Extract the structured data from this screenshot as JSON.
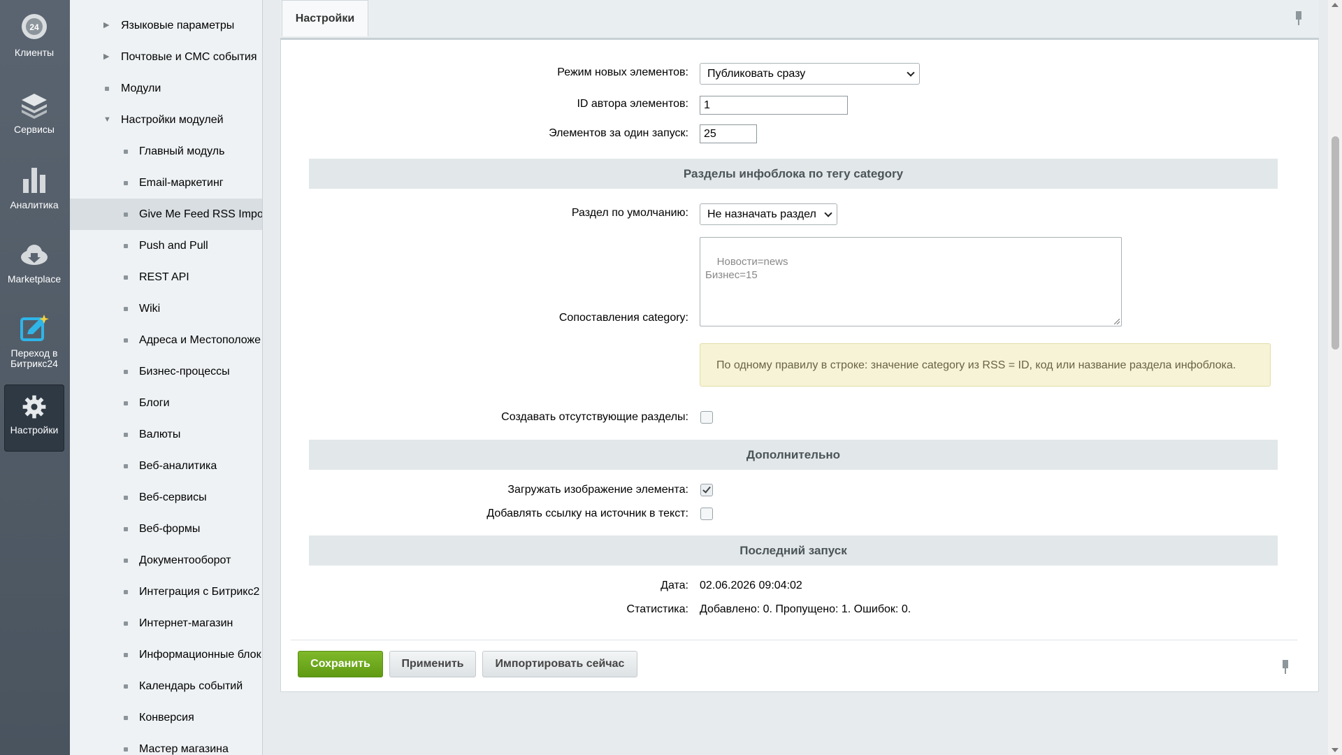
{
  "iconbar": {
    "items": [
      {
        "label": "Клиенты",
        "icon": "clients-24-icon"
      },
      {
        "label": "Сервисы",
        "icon": "layers-icon"
      },
      {
        "label": "Аналитика",
        "icon": "bar-chart-icon"
      },
      {
        "label": "Marketplace",
        "icon": "cloud-download-icon"
      },
      {
        "label": "Переход в Битрикс24",
        "icon": "edit-sparkle-icon"
      },
      {
        "label": "Настройки",
        "icon": "gear-icon",
        "active": true
      }
    ]
  },
  "tree": {
    "items": [
      {
        "label": "Языковые параметры",
        "kind": "collapsed"
      },
      {
        "label": "Почтовые и СМС события",
        "kind": "collapsed"
      },
      {
        "label": "Модули",
        "kind": "leaf"
      },
      {
        "label": "Настройки модулей",
        "kind": "expanded"
      },
      {
        "label": "Главный модуль",
        "kind": "child"
      },
      {
        "label": "Email-маркетинг",
        "kind": "child"
      },
      {
        "label": "Give Me Feed RSS Impo",
        "kind": "child",
        "selected": true
      },
      {
        "label": "Push and Pull",
        "kind": "child"
      },
      {
        "label": "REST API",
        "kind": "child"
      },
      {
        "label": "Wiki",
        "kind": "child"
      },
      {
        "label": "Адреса и Местоположе",
        "kind": "child"
      },
      {
        "label": "Бизнес-процессы",
        "kind": "child"
      },
      {
        "label": "Блоги",
        "kind": "child"
      },
      {
        "label": "Валюты",
        "kind": "child"
      },
      {
        "label": "Веб-аналитика",
        "kind": "child"
      },
      {
        "label": "Веб-сервисы",
        "kind": "child"
      },
      {
        "label": "Веб-формы",
        "kind": "child"
      },
      {
        "label": "Документооборот",
        "kind": "child"
      },
      {
        "label": "Интеграция с Битрикс2",
        "kind": "child"
      },
      {
        "label": "Интернет-магазин",
        "kind": "child"
      },
      {
        "label": "Информационные блок",
        "kind": "child"
      },
      {
        "label": "Календарь событий",
        "kind": "child"
      },
      {
        "label": "Конверсия",
        "kind": "child"
      },
      {
        "label": "Мастер магазина",
        "kind": "child"
      }
    ]
  },
  "tabs": {
    "settings": "Настройки"
  },
  "form": {
    "new_mode_label": "Режим новых элементов:",
    "new_mode_value": "Публиковать сразу",
    "author_label": "ID автора элементов:",
    "author_value": "1",
    "per_run_label": "Элементов за один запуск:",
    "per_run_value": "25",
    "section_category": "Разделы инфоблока по тегу category",
    "default_section_label": "Раздел по умолчанию:",
    "default_section_value": "Не назначать раздел",
    "mapping_label": "Сопоставления category:",
    "mapping_value": "Новости=news\nБизнес=15",
    "mapping_hint": "По одному правилу в строке: значение category из RSS = ID, код или название раздела инфоблока.",
    "create_missing_label": "Создавать отсутствующие разделы:",
    "create_missing_checked": false,
    "section_additional": "Дополнительно",
    "load_image_label": "Загружать изображение элемента:",
    "load_image_checked": true,
    "add_link_label": "Добавлять ссылку на источник в текст:",
    "add_link_checked": false,
    "section_last_run": "Последний запуск",
    "date_label": "Дата:",
    "date_value": "02.06.2026 09:04:02",
    "stats_label": "Статистика:",
    "stats_value": "Добавлено: 0. Пропущено: 1. Ошибок: 0."
  },
  "buttons": {
    "save": "Сохранить",
    "apply": "Применить",
    "import_now": "Импортировать сейчас"
  }
}
